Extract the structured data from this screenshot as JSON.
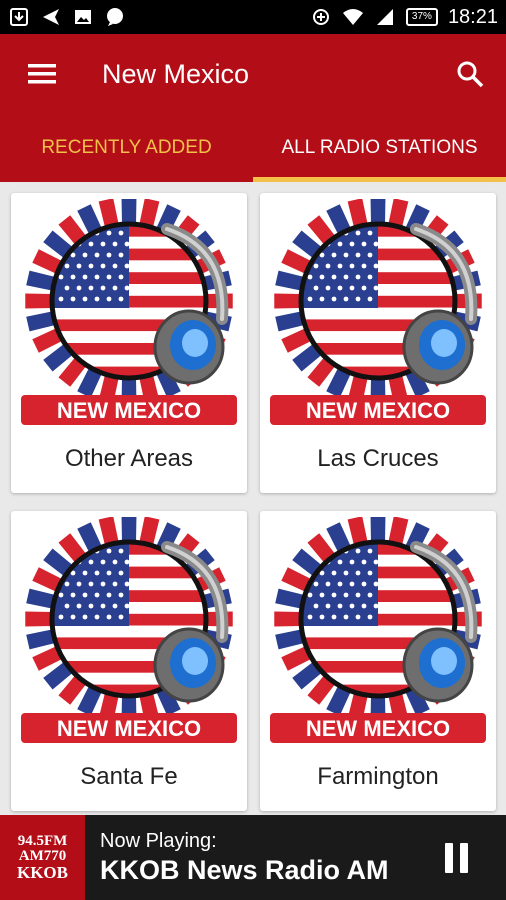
{
  "status_bar": {
    "battery": "37%",
    "time": "18:21",
    "icons": [
      "download-icon",
      "send-icon",
      "image-icon",
      "chat-icon",
      "data-saver-icon",
      "wifi-icon",
      "signal-icon",
      "battery-icon"
    ]
  },
  "app_bar": {
    "title": "New Mexico",
    "menu_icon": "hamburger-menu-icon",
    "search_icon": "search-icon",
    "color": "#b30d17"
  },
  "tabs": [
    {
      "label": "RECENTLY ADDED",
      "active": false
    },
    {
      "label": "ALL RADIO STATIONS",
      "active": true
    }
  ],
  "tab_colors": {
    "active_text": "#ffffff",
    "inactive_text": "#f3c14a",
    "indicator": "#f3c14a"
  },
  "stations": [
    {
      "name": "Other Areas",
      "badge": "NEW MEXICO"
    },
    {
      "name": "Las Cruces",
      "badge": "NEW MEXICO"
    },
    {
      "name": "Santa Fe",
      "badge": "NEW MEXICO"
    },
    {
      "name": "Farmington",
      "badge": "NEW MEXICO"
    }
  ],
  "now_playing": {
    "caption": "Now Playing:",
    "title": "KKOB News Radio AM",
    "art_lines": [
      "94.5FM",
      "AM770",
      "KKOB"
    ],
    "pause_icon": "pause-icon"
  }
}
